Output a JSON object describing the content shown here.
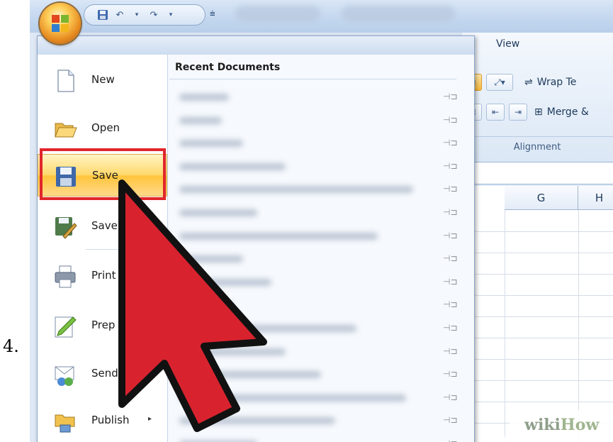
{
  "step_number": "4.",
  "ribbon": {
    "tab_view": "View",
    "wrap_text": "Wrap Te",
    "merge": "Merge &",
    "group_alignment": "Alignment"
  },
  "grid": {
    "columns": [
      "G",
      "H"
    ]
  },
  "office_menu": {
    "items": [
      {
        "label": "New",
        "icon": "new-document-icon"
      },
      {
        "label": "Open",
        "icon": "open-folder-icon"
      },
      {
        "label": "Save",
        "icon": "save-floppy-icon",
        "highlighted": true
      },
      {
        "label": "Save",
        "icon": "save-as-icon"
      },
      {
        "label": "Print",
        "icon": "printer-icon",
        "has_submenu": true
      },
      {
        "label": "Prep",
        "icon": "prepare-icon",
        "has_submenu": true
      },
      {
        "label": "Send",
        "icon": "send-icon",
        "has_submenu": true
      },
      {
        "label": "Publish",
        "icon": "publish-icon",
        "has_submenu": true
      }
    ],
    "submenu_arrow": "▸",
    "recent_heading": "Recent Documents",
    "pin_glyph": "⊣⊐"
  },
  "watermark": {
    "wiki": "wiki",
    "how": "How"
  },
  "colors": {
    "highlight_outline": "#e1262b",
    "pointer_fill": "#d8232f",
    "menu_highlight": "#ffd86b"
  }
}
